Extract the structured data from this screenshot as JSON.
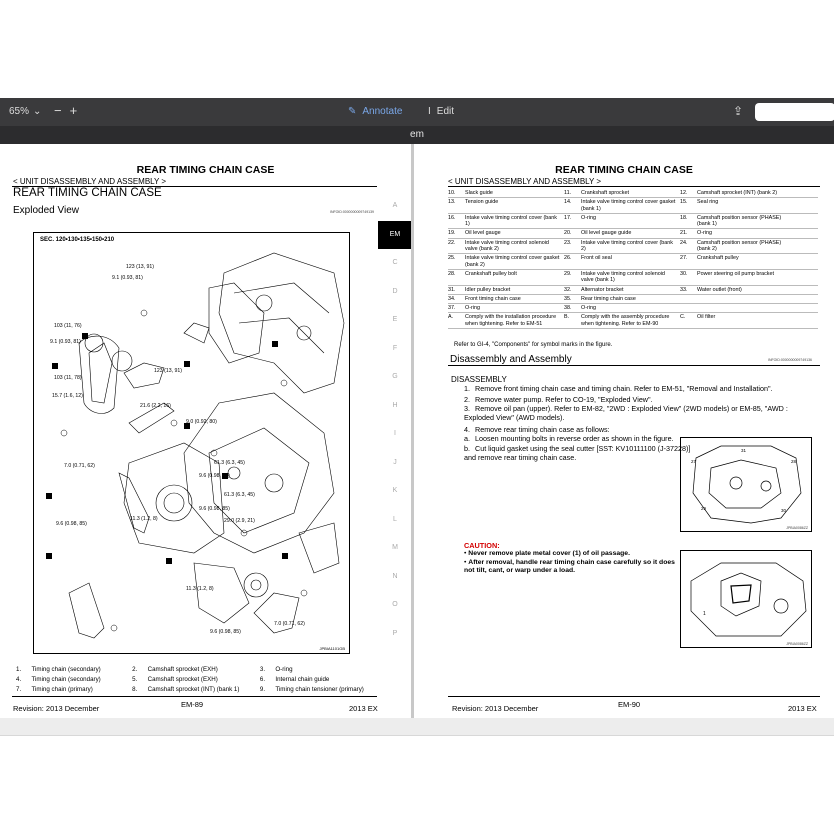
{
  "toolbar": {
    "zoom": "65%",
    "zoom_minus": "−",
    "zoom_plus": "+",
    "annotate_label": "Annotate",
    "edit_label": "Edit"
  },
  "document": {
    "title": "em"
  },
  "left_page": {
    "header": "REAR TIMING CHAIN CASE",
    "breadcrumb": "< UNIT DISASSEMBLY AND ASSEMBLY >",
    "section_title": "REAR TIMING CHAIN CASE",
    "subsection": "Exploded View",
    "info_code": "INFOID:0000000009749139",
    "side_tabs": [
      "A",
      "EM",
      "C",
      "D",
      "E",
      "F",
      "G",
      "H",
      "I",
      "J",
      "K",
      "L",
      "M",
      "N",
      "O",
      "P"
    ],
    "active_tab": "EM",
    "diagram": {
      "sec": "SEC. 120•130•135•150•210",
      "code": "JPBIA1101GB",
      "labels": [
        "9.1 (0.93, 81)",
        "123 (13, 91)",
        "103 (11, 76)",
        "9.1 (0.93, 81)",
        "103 (11, 78)",
        "15.7 (1.6, 12)",
        "21.6 (2.2, 16)",
        "123 (13, 91)",
        "9.0 (0.92, 80)",
        "7.0 (0.71, 62)",
        "61.3 (6.3, 45)",
        "9.6 (0.98, 85)",
        "61.3 (6.3, 45)",
        "9.6 (0.98, 85)",
        "11.3 (1.2, 8)",
        "29.0 (2.9, 21)",
        "9.6 (0.98, 85)",
        "11.3 (1.2, 8)",
        "7.0 (0.71, 62)",
        "9.6 (0.98, 85)"
      ]
    },
    "legend": [
      [
        "1.",
        "Timing chain (secondary)",
        "2.",
        "Camshaft sprocket (EXH)",
        "3.",
        "O-ring"
      ],
      [
        "4.",
        "Timing chain (secondary)",
        "5.",
        "Camshaft sprocket (EXH)",
        "6.",
        "Internal chain guide"
      ],
      [
        "7.",
        "Timing chain (primary)",
        "8.",
        "Camshaft sprocket (INT) (bank 1)",
        "9.",
        "Timing chain tensioner (primary)"
      ]
    ],
    "footer": {
      "revision": "Revision: 2013 December",
      "page": "EM-89",
      "model": "2013 EX"
    }
  },
  "right_page": {
    "header": "REAR TIMING CHAIN CASE",
    "breadcrumb": "< UNIT DISASSEMBLY AND ASSEMBLY >",
    "components": [
      [
        "10.",
        "Slack guide",
        "11.",
        "Crankshaft sprocket",
        "12.",
        "Camshaft sprocket (INT) (bank 2)"
      ],
      [
        "13.",
        "Tension guide",
        "14.",
        "Intake valve timing control cover gasket (bank 1)",
        "15.",
        "Seal ring"
      ],
      [
        "16.",
        "Intake valve timing control cover (bank 1)",
        "17.",
        "O-ring",
        "18.",
        "Camshaft position sensor (PHASE) (bank 1)"
      ],
      [
        "19.",
        "Oil level gauge",
        "20.",
        "Oil level gauge guide",
        "21.",
        "O-ring"
      ],
      [
        "22.",
        "Intake valve timing control solenoid valve (bank 2)",
        "23.",
        "Intake valve timing control cover (bank 2)",
        "24.",
        "Camshaft position sensor (PHASE) (bank 2)"
      ],
      [
        "25.",
        "Intake valve timing control cover gasket (bank 2)",
        "26.",
        "Front oil seal",
        "27.",
        "Crankshaft pulley"
      ],
      [
        "28.",
        "Crankshaft pulley bolt",
        "29.",
        "Intake valve timing control solenoid valve (bank 1)",
        "30.",
        "Power steering oil pump bracket"
      ],
      [
        "31.",
        "Idler pulley bracket",
        "32.",
        "Alternator bracket",
        "33.",
        "Water outlet (front)"
      ],
      [
        "34.",
        "Front timing chain case",
        "35.",
        "Rear timing chain case",
        "",
        ""
      ],
      [
        "37.",
        "O-ring",
        "38.",
        "O-ring",
        "",
        ""
      ],
      [
        "A.",
        "Comply with the installation procedure when tightening. Refer to EM-51",
        "B.",
        "Comply with the assembly procedure when tightening. Refer to EM-90",
        "C.",
        "Oil filter"
      ]
    ],
    "refer_note": "Refer to GI-4, \"Components\" for symbol marks in the figure.",
    "section_title": "Disassembly and Assembly",
    "info_code": "INFOID:0000000009749136",
    "subsection": "DISASSEMBLY",
    "steps": [
      "Remove front timing chain case and timing chain. Refer to EM-51, \"Removal and Installation\".",
      "Remove water pump. Refer to CO-19, \"Exploded View\".",
      "Remove oil pan (upper). Refer to EM-82, \"2WD : Exploded View\" (2WD models) or EM-85, \"AWD : Exploded View\" (AWD models).",
      "Remove rear timing chain case as follows:",
      "Loosen mounting bolts in reverse order as shown in the figure.",
      "Cut liquid gasket using the seal cutter [SST: KV10111100 (J-37228)] and remove rear timing chain case."
    ],
    "step_bullets": [
      "1.",
      "2.",
      "3.",
      "4.",
      "a.",
      "b."
    ],
    "caution_title": "CAUTION:",
    "cautions": [
      "Never remove plate metal cover (1) of oil passage.",
      "After removal, handle rear timing chain case carefully so it does not tilt, cant, or warp under a load."
    ],
    "fig1_code": "JPBIA0086ZZ",
    "fig2_code": "JPBIA0086ZZ",
    "footer": {
      "revision": "Revision: 2013 December",
      "page": "EM-90",
      "model": "2013 EX"
    }
  }
}
